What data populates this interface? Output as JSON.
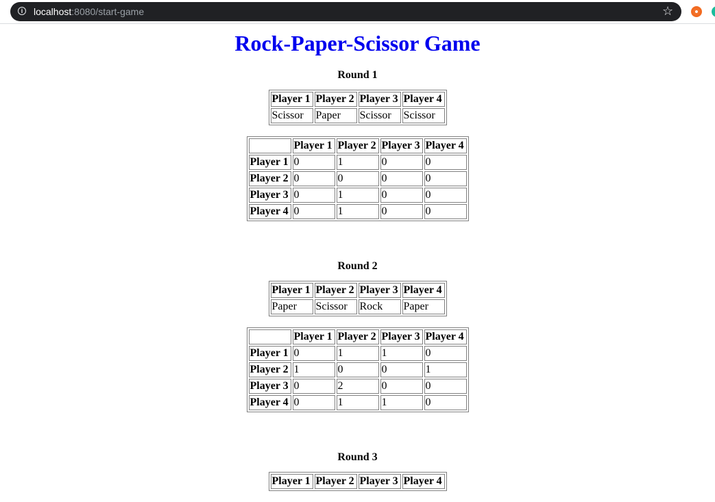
{
  "browser": {
    "url_host": "localhost",
    "url_rest": ":8080/start-game"
  },
  "page": {
    "title": "Rock-Paper-Scissor Game"
  },
  "players": [
    "Player 1",
    "Player 2",
    "Player 3",
    "Player 4"
  ],
  "rounds": [
    {
      "title": "Round 1",
      "choices": [
        "Scissor",
        "Paper",
        "Scissor",
        "Scissor"
      ],
      "matrix": [
        [
          "0",
          "1",
          "0",
          "0"
        ],
        [
          "0",
          "0",
          "0",
          "0"
        ],
        [
          "0",
          "1",
          "0",
          "0"
        ],
        [
          "0",
          "1",
          "0",
          "0"
        ]
      ]
    },
    {
      "title": "Round 2",
      "choices": [
        "Paper",
        "Scissor",
        "Rock",
        "Paper"
      ],
      "matrix": [
        [
          "0",
          "1",
          "1",
          "0"
        ],
        [
          "1",
          "0",
          "0",
          "1"
        ],
        [
          "0",
          "2",
          "0",
          "0"
        ],
        [
          "0",
          "1",
          "1",
          "0"
        ]
      ]
    },
    {
      "title": "Round 3",
      "choices": [],
      "matrix": []
    }
  ]
}
